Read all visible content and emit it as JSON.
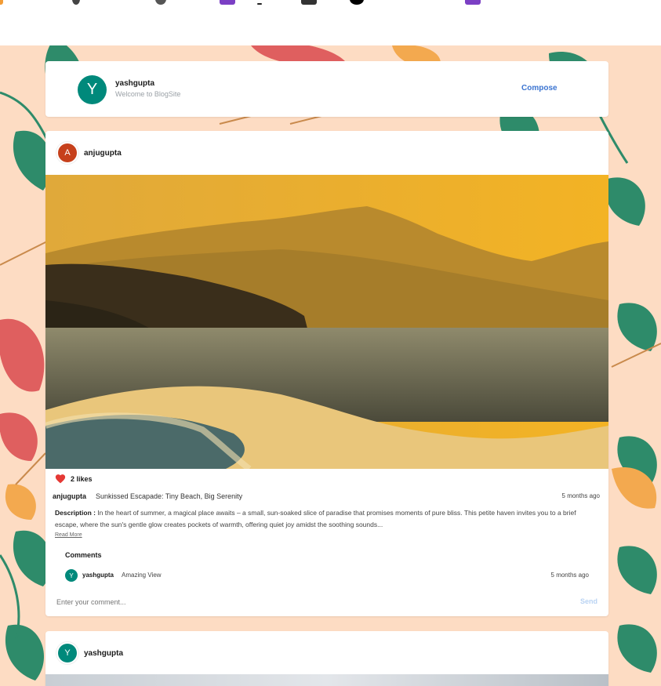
{
  "colors": {
    "background": "#fddcc3",
    "leaf_green": "#2e8b6a",
    "leaf_red": "#df5f5f",
    "leaf_orange": "#f3a94f",
    "avatar_teal": "#00897b",
    "avatar_red": "#c6401b",
    "accent_blue": "#3b74d1",
    "heart_red": "#e53935"
  },
  "header": {
    "avatar_letter": "Y",
    "username": "yashgupta",
    "subtitle": "Welcome to BlogSite",
    "compose_label": "Compose"
  },
  "post1": {
    "avatar_letter": "A",
    "author": "anjugupta",
    "likes": "2 likes",
    "caption_user": "anjugupta",
    "title": "Sunkissed Escapade: Tiny Beach, Big Serenity",
    "time": "5 months ago",
    "description_label": "Description :",
    "description": " In the heart of summer, a magical place awaits – a small, sun-soaked slice of paradise that promises moments of pure bliss. This petite haven invites you to a brief escape, where the sun's gentle glow creates pockets of warmth, offering quiet joy amidst the soothing sounds...",
    "read_more": "Read More",
    "comments_heading": "Comments",
    "comments": [
      {
        "avatar_letter": "Y",
        "user": "yashgupta",
        "text": "Amazing View",
        "time": "5 months ago"
      }
    ],
    "comment_placeholder": "Enter your comment...",
    "send_label": "Send"
  },
  "post2": {
    "avatar_letter": "Y",
    "author": "yashgupta"
  }
}
